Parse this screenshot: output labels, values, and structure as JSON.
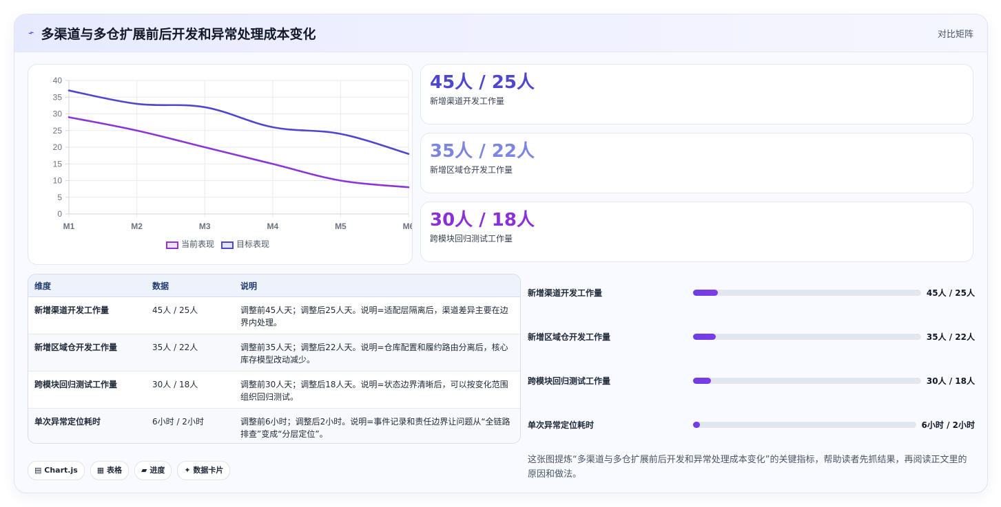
{
  "header": {
    "title": "多渠道与多仓扩展前后开发和异常处理成本变化",
    "right_label": "对比矩阵",
    "icon": "chart-trend-icon"
  },
  "colors": {
    "series_current": "#8b35d6",
    "series_target": "#4f46d0",
    "stat1": "#4f46d0",
    "stat2": "#7c86e0",
    "stat3": "#8b2fd6"
  },
  "chart_data": {
    "type": "line",
    "x": [
      "M1",
      "M2",
      "M3",
      "M4",
      "M5",
      "M6"
    ],
    "series": [
      {
        "name": "当前表现",
        "values": [
          29,
          25,
          20,
          15,
          10,
          8
        ]
      },
      {
        "name": "目标表现",
        "values": [
          37,
          33,
          32,
          26,
          24,
          18
        ]
      }
    ],
    "ylim": [
      0,
      40
    ],
    "yticks": [
      0,
      5,
      10,
      15,
      20,
      25,
      30,
      35,
      40
    ],
    "grid": true,
    "legend_position": "bottom"
  },
  "stats": [
    {
      "value": "45人 / 25人",
      "label": "新增渠道开发工作量"
    },
    {
      "value": "35人 / 22人",
      "label": "新增区域仓开发工作量"
    },
    {
      "value": "30人 / 18人",
      "label": "跨模块回归测试工作量"
    }
  ],
  "table": {
    "headers": [
      "维度",
      "数据",
      "说明"
    ],
    "rows": [
      {
        "dim": "新增渠道开发工作量",
        "data": "45人 / 25人",
        "desc": "调整前45人天；调整后25人天。说明=适配层隔离后，渠道差异主要在边界内处理。"
      },
      {
        "dim": "新增区域仓开发工作量",
        "data": "35人 / 22人",
        "desc": "调整前35人天；调整后22人天。说明=仓库配置和履约路由分离后，核心库存模型改动减少。"
      },
      {
        "dim": "跨模块回归测试工作量",
        "data": "30人 / 18人",
        "desc": "调整前30人天；调整后18人天。说明=状态边界清晰后，可以按变化范围组织回归测试。"
      },
      {
        "dim": "单次异常定位耗时",
        "data": "6小时 / 2小时",
        "desc": "调整前6小时；调整后2小时。说明=事件记录和责任边界让问题从“全链路排查”变成“分层定位”。"
      }
    ]
  },
  "progress": [
    {
      "label": "新增渠道开发工作量",
      "value": "45人 / 25人",
      "fraction": 0.11
    },
    {
      "label": "新增区域仓开发工作量",
      "value": "35人 / 22人",
      "fraction": 0.1
    },
    {
      "label": "跨模块回归测试工作量",
      "value": "30人 / 18人",
      "fraction": 0.08
    },
    {
      "label": "单次异常定位耗时",
      "value": "6小时 / 2小时",
      "fraction": 0.03
    }
  ],
  "tags": [
    {
      "icon": "chart-icon",
      "glyph": "▤",
      "label": "Chart.js"
    },
    {
      "icon": "table-icon",
      "glyph": "▦",
      "label": "表格"
    },
    {
      "icon": "progress-icon",
      "glyph": "▰",
      "label": "进度"
    },
    {
      "icon": "sparkle-icon",
      "glyph": "✦",
      "label": "数据卡片"
    }
  ],
  "note": "这张图提炼“多渠道与多仓扩展前后开发和异常处理成本变化”的关键指标，帮助读者先抓结果，再阅读正文里的原因和做法。"
}
